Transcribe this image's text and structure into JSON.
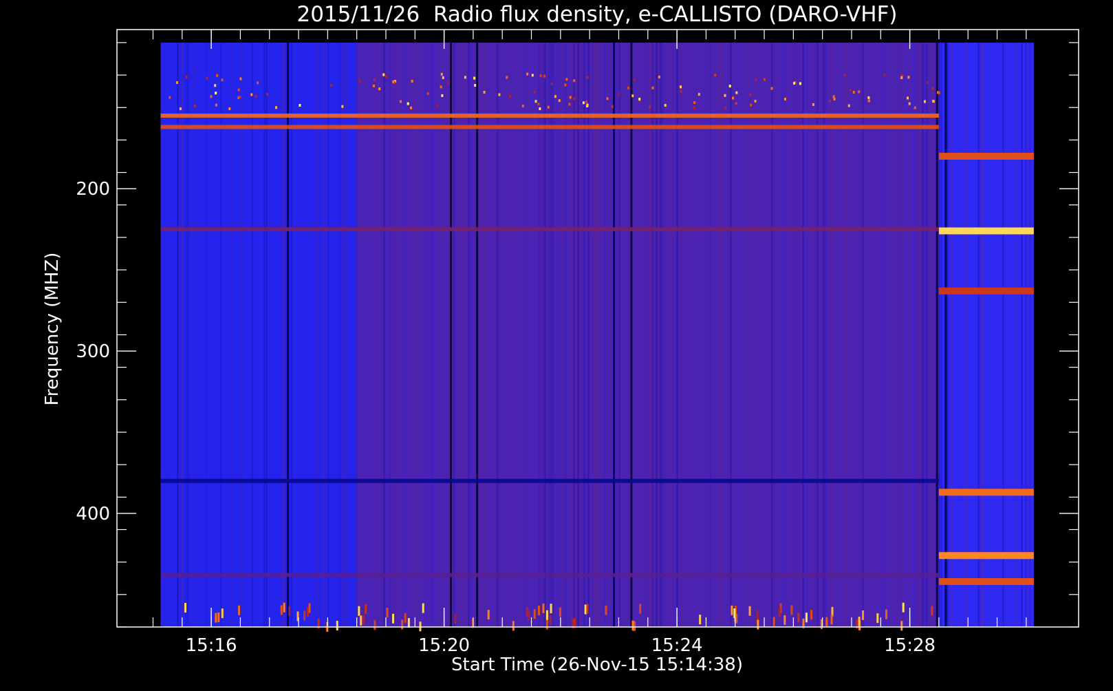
{
  "chart_data": {
    "type": "heatmap",
    "title": "2015/11/26  Radio flux density, e-CALLISTO (DARO-VHF)",
    "xlabel": "Start Time (26-Nov-15 15:14:38)",
    "ylabel": "Frequency (MHZ)",
    "x_ticks": [
      {
        "label": "15:16",
        "minutes": 16
      },
      {
        "label": "15:20",
        "minutes": 20
      },
      {
        "label": "15:24",
        "minutes": 24
      },
      {
        "label": "15:28",
        "minutes": 28
      }
    ],
    "y_ticks": [
      {
        "label": "200",
        "value": 200
      },
      {
        "label": "300",
        "value": 300
      },
      {
        "label": "400",
        "value": 400
      }
    ],
    "xlim_minutes": [
      14.38,
      30.9
    ],
    "ylim_mhz": [
      470,
      102
    ],
    "data_extent_minutes": [
      15.13,
      30.13
    ],
    "data_extent_mhz": [
      110,
      470
    ],
    "colormap": [
      "#000000",
      "#0a0aa0",
      "#2a2aff",
      "#5a1f8f",
      "#c0261a",
      "#ff7a1a",
      "#ffff6a"
    ],
    "colors": {
      "background": "#000000",
      "foreground": "#ffffff"
    },
    "segments": [
      {
        "t_start": 15.13,
        "t_end": 18.5,
        "level": 0.3
      },
      {
        "t_start": 18.5,
        "t_end": 28.5,
        "level": 0.45
      },
      {
        "t_start": 28.5,
        "t_end": 30.13,
        "level": 0.35
      }
    ],
    "horizontal_bands": [
      {
        "mhz": 155,
        "level": 0.8
      },
      {
        "mhz": 162,
        "level": 0.75
      },
      {
        "mhz": 225,
        "level": 0.55
      },
      {
        "mhz": 380,
        "level": 0.15
      },
      {
        "mhz": 438,
        "level": 0.5
      }
    ],
    "burst_segment_bands": [
      {
        "mhz": 180,
        "level": 0.75
      },
      {
        "mhz": 226,
        "level": 0.95
      },
      {
        "mhz": 263,
        "level": 0.7
      },
      {
        "mhz": 387,
        "level": 0.8
      },
      {
        "mhz": 426,
        "level": 0.85
      },
      {
        "mhz": 442,
        "level": 0.75
      }
    ]
  }
}
